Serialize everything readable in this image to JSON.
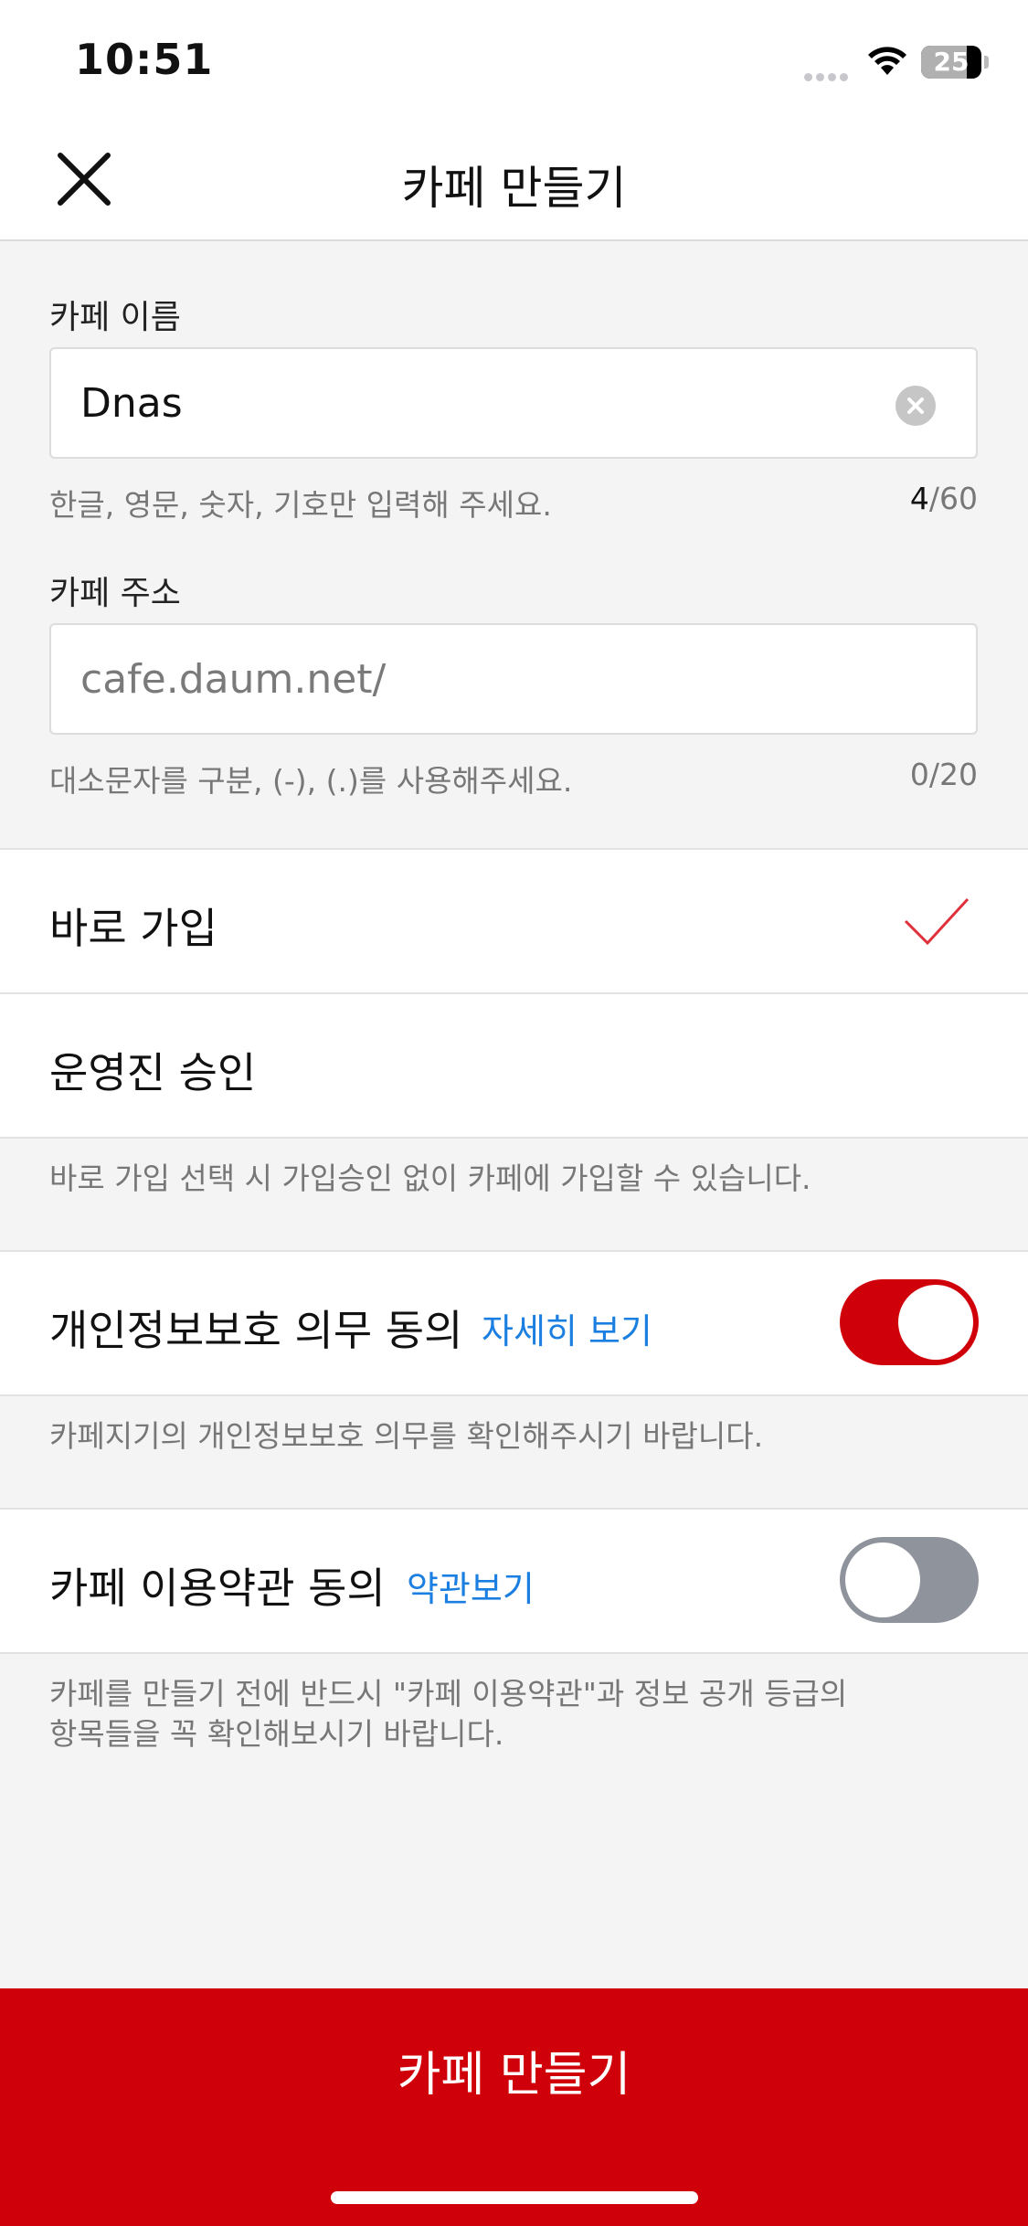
{
  "status_bar": {
    "time": "10:51",
    "battery_level": "25"
  },
  "header": {
    "title": "카페 만들기",
    "close_icon": "close-icon"
  },
  "form": {
    "name": {
      "label": "카페 이름",
      "value": "Dnas",
      "helper": "한글, 영문, 숫자, 기호만 입력해 주세요.",
      "count_current": "4",
      "count_max": "/60"
    },
    "address": {
      "label": "카페 주소",
      "placeholder": "cafe.daum.net/",
      "helper": "대소문자를 구분, (-), (.)를 사용해주세요.",
      "count": "0/20"
    }
  },
  "join_options": {
    "instant_label": "바로 가입",
    "instant_selected": true,
    "approval_label": "운영진 승인",
    "note": "바로 가입 선택 시 가입승인 없이 카페에 가입할 수 있습니다."
  },
  "privacy": {
    "label": "개인정보보호 의무 동의",
    "link": "자세히 보기",
    "toggle_on": true,
    "note": "카페지기의 개인정보보호 의무를 확인해주시기 바랍니다."
  },
  "terms": {
    "label": "카페 이용약관 동의",
    "link": "약관보기",
    "toggle_on": false,
    "note_line1": "카페를 만들기 전에 반드시 \"카페 이용약관\"과 정보 공개 등급의",
    "note_line2": "항목들을 꼭 확인해보시기 바랍니다."
  },
  "submit": {
    "label": "카페 만들기"
  },
  "colors": {
    "accent": "#d0000a",
    "link": "#1a7fe0",
    "toggle_off": "#8e939c"
  }
}
